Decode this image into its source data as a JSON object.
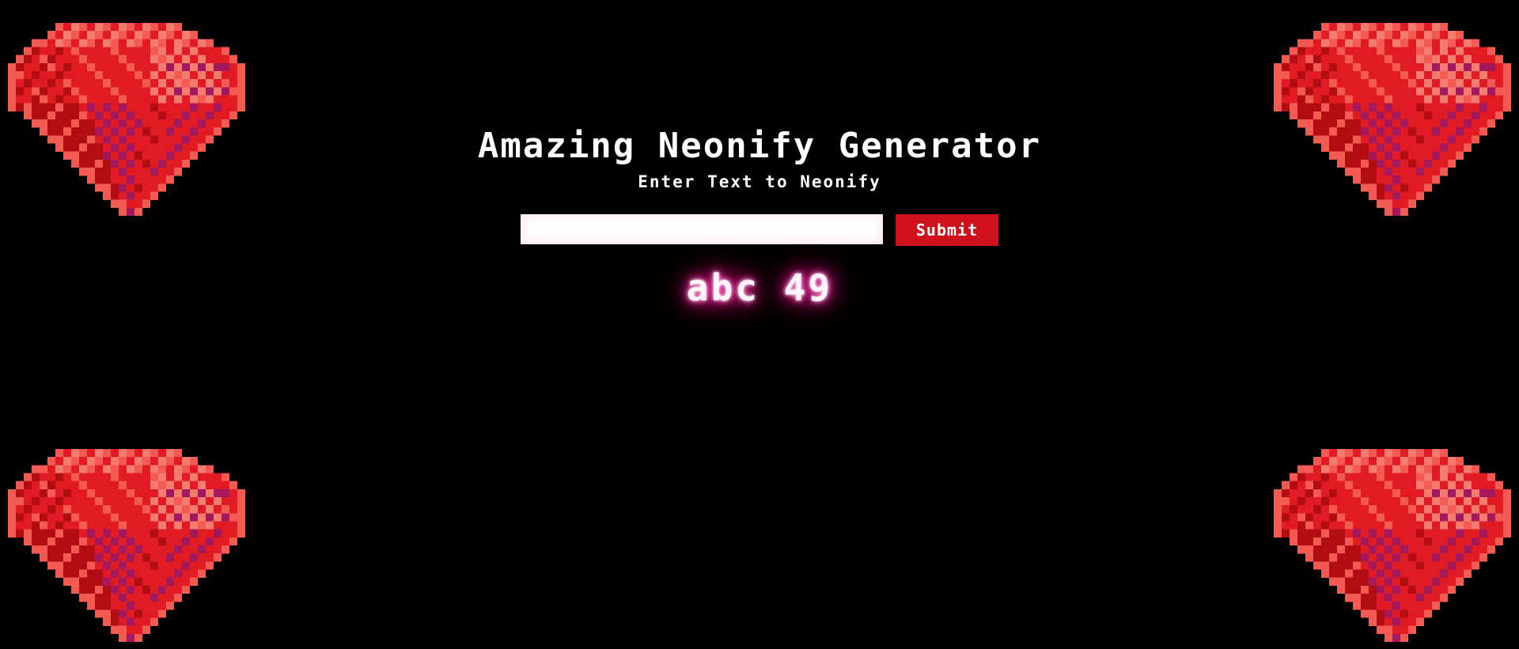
{
  "page": {
    "title": "Amazing Neonify Generator",
    "subtitle": "Enter Text to Neonify"
  },
  "form": {
    "input_value": "",
    "input_placeholder": "",
    "submit_label": "Submit"
  },
  "output": {
    "neon_text": "abc 49"
  },
  "decorations": {
    "corner_image": "red-pixel-gem-icon"
  },
  "colors": {
    "background": "#000000",
    "button": "#d0101b",
    "neon_glow": "#ff1493",
    "gem_dark": "#b30d14",
    "gem_mid": "#e01b24",
    "gem_light": "#f25a52",
    "gem_highlight": "#f47b70",
    "gem_purple": "#a3195b"
  }
}
